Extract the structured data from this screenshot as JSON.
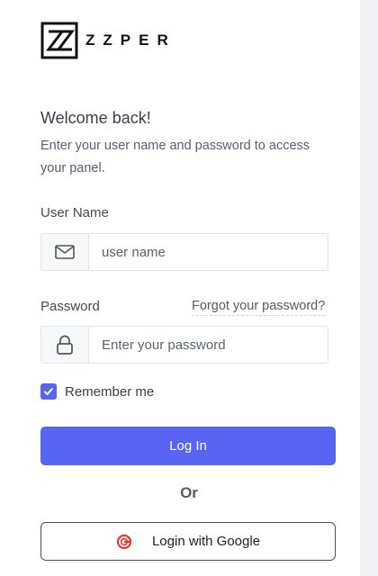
{
  "brand": {
    "name": "ZZPER",
    "mark_color": "#111111"
  },
  "heading": {
    "title": "Welcome back!",
    "subtitle": "Enter your user name and password to access your panel."
  },
  "username": {
    "label": "User Name",
    "placeholder": "user name",
    "icon": "envelope-icon"
  },
  "password": {
    "label": "Password",
    "placeholder": "Enter your password",
    "icon": "lock-icon",
    "forgot_link": "Forgot your password?"
  },
  "remember": {
    "label": "Remember me",
    "checked": true
  },
  "actions": {
    "login": "Log In",
    "or": "Or",
    "google": "Login with Google"
  },
  "colors": {
    "accent": "#5865f2",
    "google_icon": "#e53935"
  }
}
